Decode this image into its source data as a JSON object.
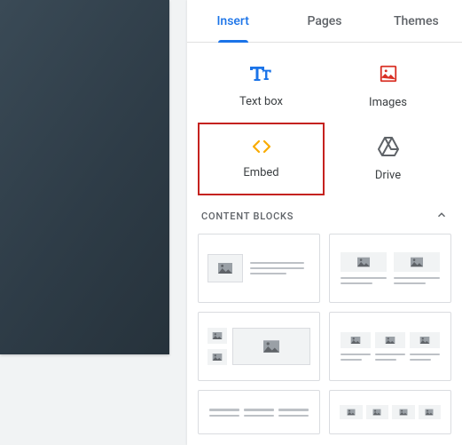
{
  "tabs": {
    "insert": "Insert",
    "pages": "Pages",
    "themes": "Themes",
    "activeIndex": 0
  },
  "tools": {
    "textbox": "Text box",
    "images": "Images",
    "embed": "Embed",
    "drive": "Drive"
  },
  "sections": {
    "contentBlocks": "CONTENT BLOCKS"
  }
}
